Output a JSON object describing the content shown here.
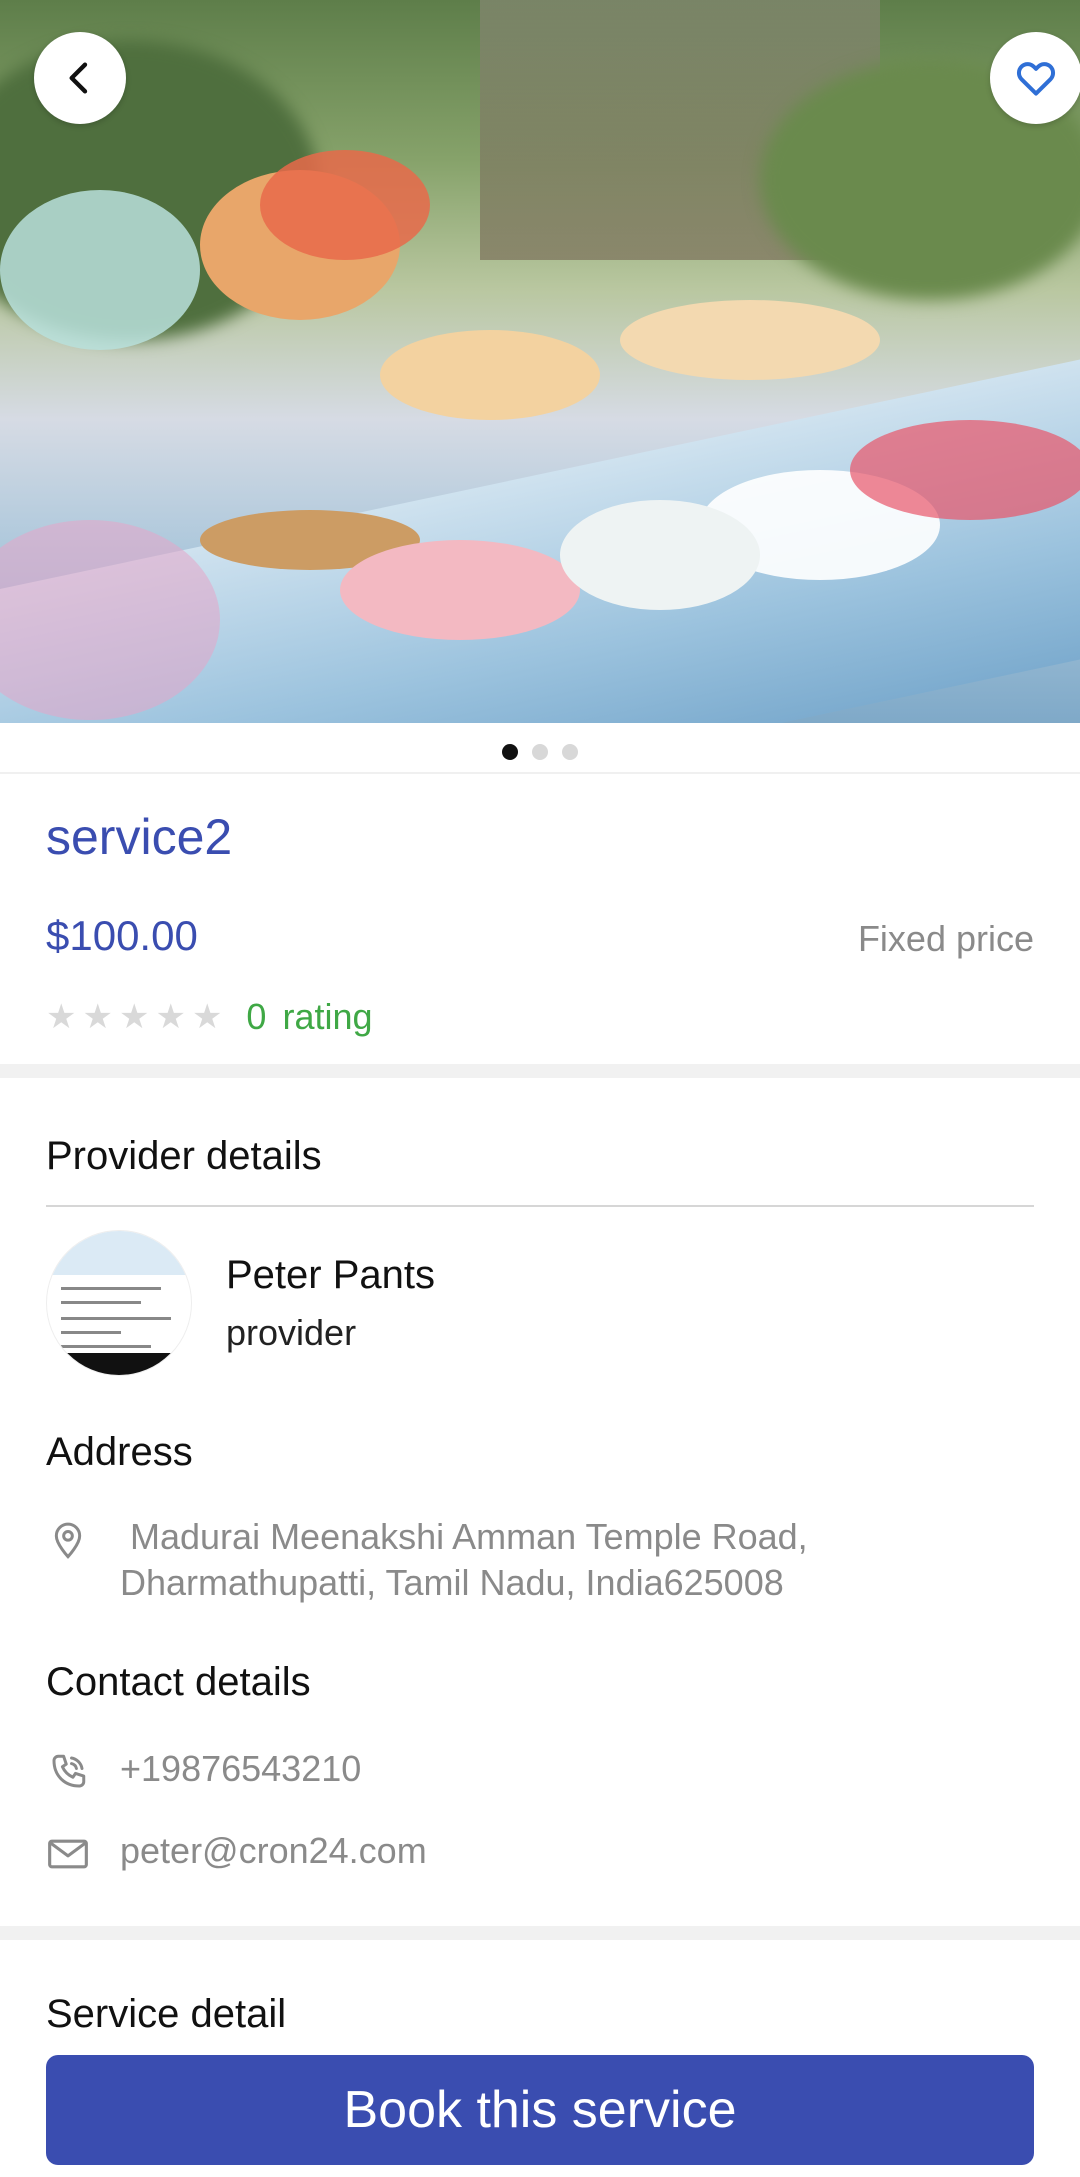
{
  "hero": {
    "image_alt": "",
    "pages": 3,
    "active_page": 0
  },
  "icons": {
    "back": "chevron-left-icon",
    "favorite": "heart-outline-icon",
    "location": "map-pin-icon",
    "phone": "phone-icon",
    "email": "mail-icon",
    "star": "star-icon"
  },
  "service": {
    "title": "service2",
    "price": "$100.00",
    "price_type": "Fixed price",
    "rating_value": "0",
    "rating_label": "rating",
    "stars_filled": 0,
    "stars_total": 5
  },
  "provider": {
    "heading": "Provider details",
    "name": "Peter Pants",
    "role": "provider"
  },
  "address": {
    "heading": "Address",
    "line1": " Madurai Meenakshi Amman Temple Road,",
    "line2": "Dharmathupatti, Tamil Nadu, India625008"
  },
  "contact": {
    "heading": "Contact details",
    "phone": "+19876543210",
    "email": "peter@cron24.com"
  },
  "service_detail": {
    "heading": "Service detail"
  },
  "actions": {
    "book_label": "Book this service"
  },
  "colors": {
    "accent": "#3a4db0",
    "rating": "#3fa845",
    "muted": "#8a8a8a",
    "star_empty": "#d9d9d9"
  }
}
